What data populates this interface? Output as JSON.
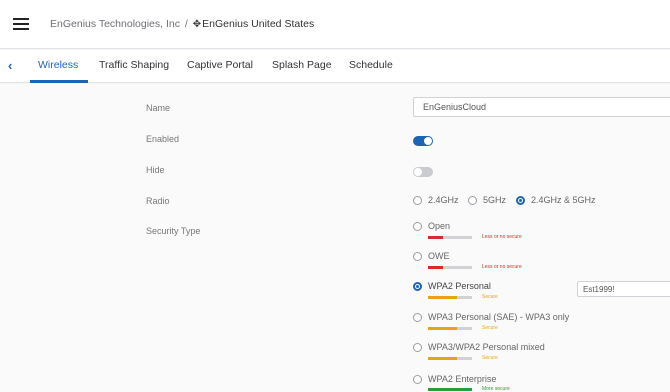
{
  "header": {
    "org": "EnGenius Technologies, Inc",
    "separator": "/",
    "site_icon": "✥",
    "site": "EnGenius United States"
  },
  "tabs": [
    "Wireless",
    "Traffic Shaping",
    "Captive Portal",
    "Splash Page",
    "Schedule"
  ],
  "active_tab": "Wireless",
  "form": {
    "name_label": "Name",
    "name_value": "EnGeniusCloud",
    "enabled_label": "Enabled",
    "enabled": true,
    "hide_label": "Hide",
    "hide": false,
    "radio_label": "Radio",
    "radio_options": [
      "2.4GHz",
      "5GHz",
      "2.4GHz & 5GHz"
    ],
    "radio_selected": "2.4GHz & 5GHz",
    "security_label": "Security Type",
    "security_options": [
      {
        "label": "Open",
        "strength": "Less or no secure",
        "color": "#d92b2b"
      },
      {
        "label": "OWE",
        "strength": "Less or no secure",
        "color": "#d92b2b"
      },
      {
        "label": "WPA2 Personal",
        "strength": "Secure",
        "color": "#e8a317"
      },
      {
        "label": "WPA3 Personal (SAE) - WPA3 only",
        "strength": "Secure",
        "color": "#e8a317"
      },
      {
        "label": "WPA3/WPA2 Personal mixed",
        "strength": "Secure",
        "color": "#e8a317"
      },
      {
        "label": "WPA2 Enterprise",
        "strength": "More secure",
        "color": "#2a9d3a"
      }
    ],
    "security_selected": "WPA2 Personal",
    "passphrase_value": "Est1999!"
  },
  "colors": {
    "accent": "#1e64b4",
    "insecure": "#d92b2b",
    "secure": "#e8a317",
    "more_secure": "#2a9d3a"
  }
}
